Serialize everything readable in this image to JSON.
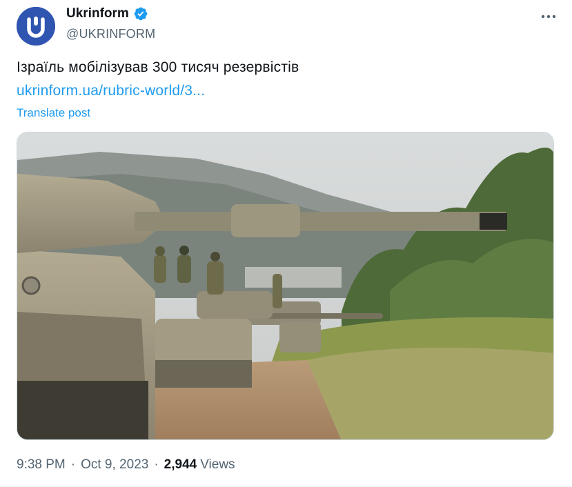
{
  "author": {
    "display_name": "Ukrinform",
    "handle": "@UKRINFORM",
    "verified": true,
    "avatar_letter": "U",
    "avatar_color": "#2f55b1",
    "verified_color": "#1d9bf0"
  },
  "post": {
    "text": "Ізраїль мобілізував 300 тисяч резервістів",
    "link": "ukrinform.ua/rubric-world/3...",
    "translate_label": "Translate post",
    "image_description_icon": "photo"
  },
  "meta": {
    "time": "9:38 PM",
    "separator1": "·",
    "date": "Oct 9, 2023",
    "separator2": "·",
    "views_count": "2,944",
    "views_label": "Views"
  },
  "colors": {
    "link": "#1d9bf0",
    "secondary_text": "#536471",
    "primary_text": "#0f1419"
  },
  "icons": {
    "more": "more-icon",
    "verified": "verified-badge-icon"
  }
}
